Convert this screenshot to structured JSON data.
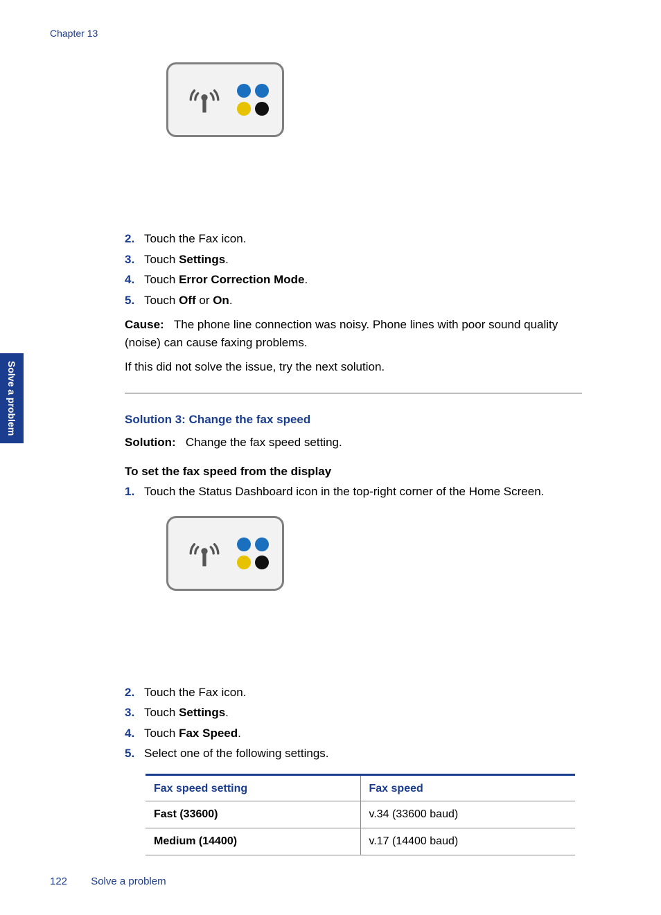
{
  "header": {
    "chapter": "Chapter 13"
  },
  "sideTab": {
    "label": "Solve a problem"
  },
  "section1": {
    "steps": [
      {
        "num": "2.",
        "text": "Touch the Fax icon."
      },
      {
        "num": "3.",
        "pre": "Touch ",
        "bold": "Settings",
        "post": "."
      },
      {
        "num": "4.",
        "pre": "Touch ",
        "bold": "Error Correction Mode",
        "post": "."
      },
      {
        "num": "5.",
        "pre": "Touch ",
        "bold": "Off",
        "mid": " or ",
        "bold2": "On",
        "post": "."
      }
    ],
    "causeLabel": "Cause:",
    "causeText": "The phone line connection was noisy. Phone lines with poor sound quality (noise) can cause faxing problems.",
    "followup": "If this did not solve the issue, try the next solution."
  },
  "section2": {
    "heading": "Solution 3: Change the fax speed",
    "solutionLabel": "Solution:",
    "solutionText": "Change the fax speed setting.",
    "subheading": "To set the fax speed from the display",
    "stepsA": [
      {
        "num": "1.",
        "text": "Touch the Status Dashboard icon in the top-right corner of the Home Screen."
      }
    ],
    "stepsB": [
      {
        "num": "2.",
        "text": "Touch the Fax icon."
      },
      {
        "num": "3.",
        "pre": "Touch ",
        "bold": "Settings",
        "post": "."
      },
      {
        "num": "4.",
        "pre": "Touch ",
        "bold": "Fax Speed",
        "post": "."
      },
      {
        "num": "5.",
        "text": "Select one of the following settings."
      }
    ],
    "table": {
      "headers": [
        "Fax speed setting",
        "Fax speed"
      ],
      "rows": [
        {
          "label": "Fast (33600)",
          "value": "v.34 (33600 baud)"
        },
        {
          "label": "Medium (14400)",
          "value": "v.17 (14400 baud)"
        }
      ]
    }
  },
  "footer": {
    "pageNumber": "122",
    "sectionName": "Solve a problem"
  }
}
